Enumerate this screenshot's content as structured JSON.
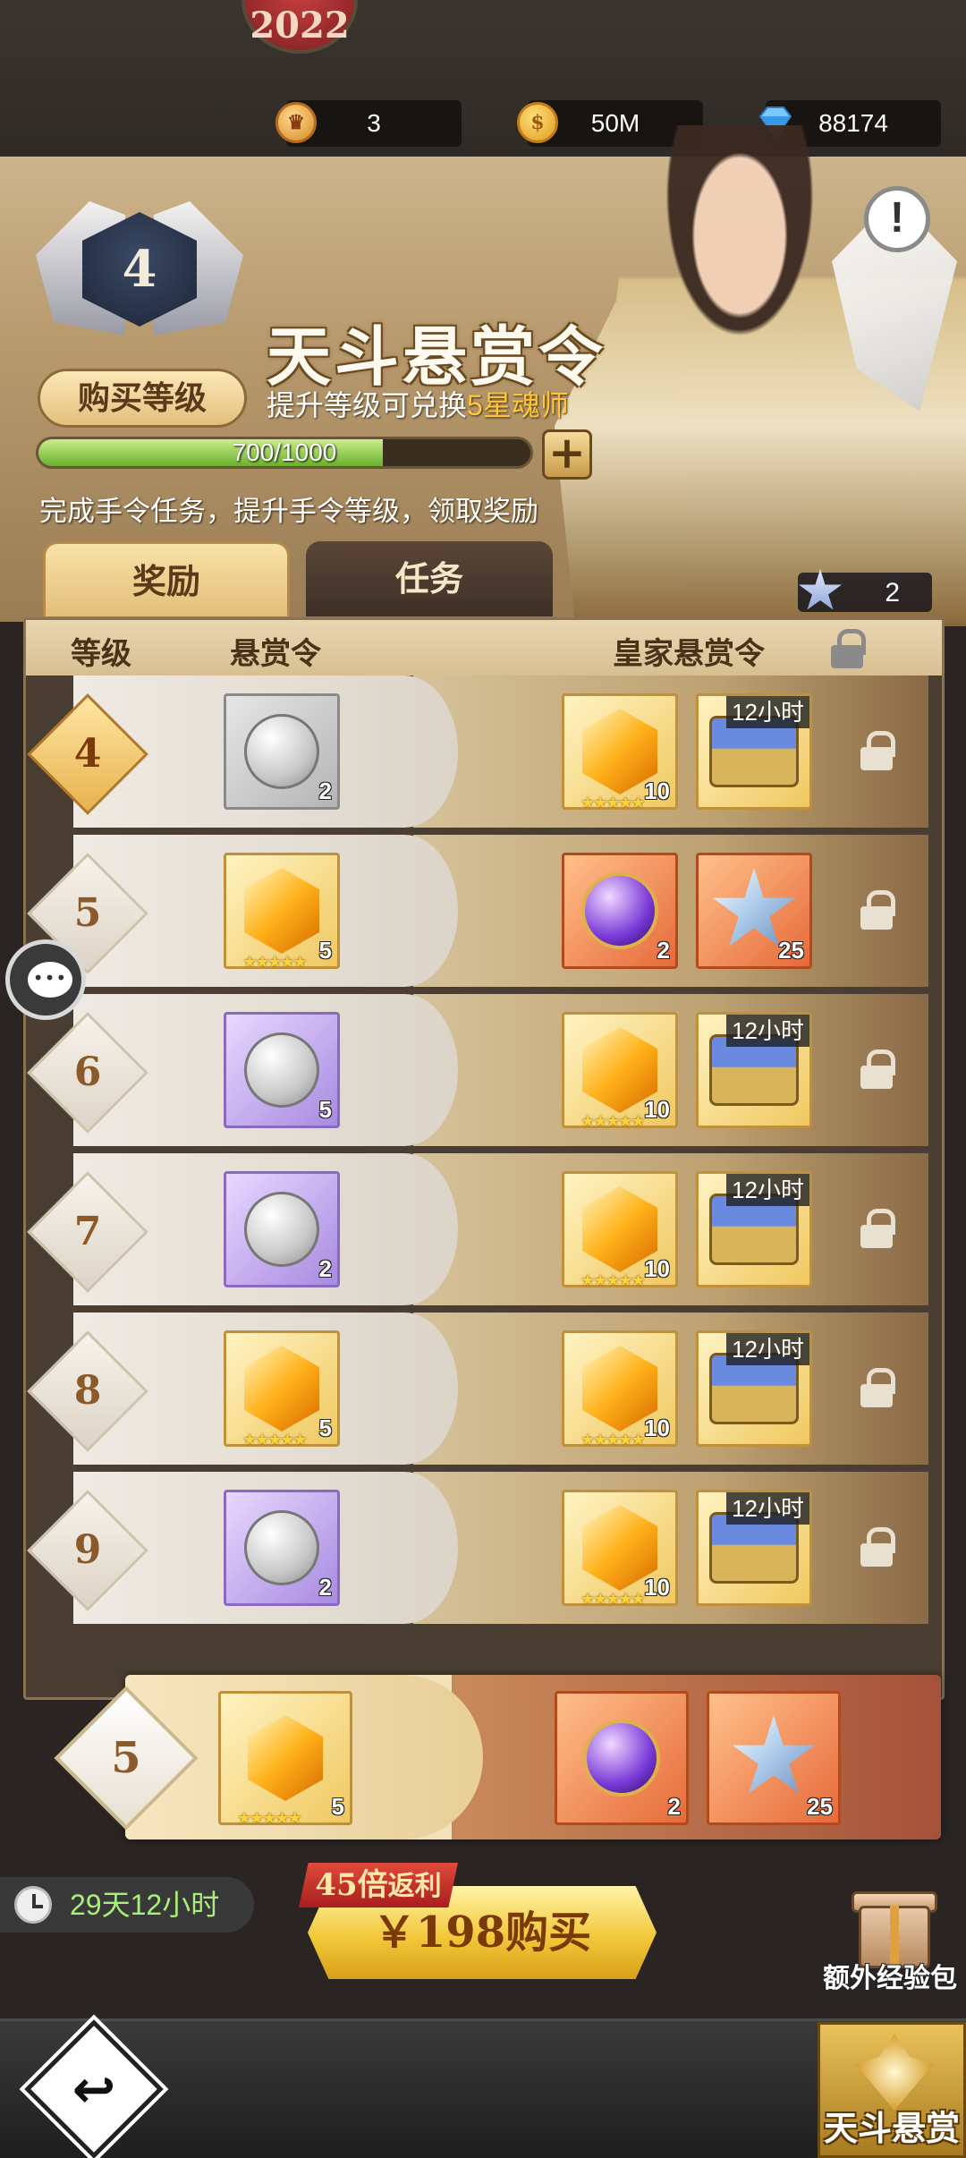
{
  "header": {
    "medal_text": "2022",
    "resources": [
      {
        "icon": "bounty-coin-icon",
        "value": "3"
      },
      {
        "icon": "gold-coin-icon",
        "value": "50M"
      },
      {
        "icon": "diamond-icon",
        "value": "88174"
      }
    ]
  },
  "pass": {
    "level": "4",
    "buy_level_label": "购买等级",
    "title": "天斗悬赏令",
    "subtitle_prefix": "提升等级可兑换",
    "subtitle_highlight": "5星魂师",
    "progress_text": "700/1000",
    "progress_fraction": 0.7,
    "plus_label": "+",
    "hint": "完成手令任务，提升手令等级，领取奖励",
    "info_label": "!",
    "star_count": "2"
  },
  "tabs": [
    {
      "label": "奖励",
      "active": true
    },
    {
      "label": "任务",
      "active": false
    }
  ],
  "list": {
    "headers": {
      "level": "等级",
      "free": "悬赏令",
      "royal": "皇家悬赏令"
    },
    "rows": [
      {
        "level": "4",
        "active": true,
        "free": {
          "icon": "silver-coin-icon",
          "bg": "gray",
          "qty": "2"
        },
        "royal": [
          {
            "icon": "crystal-icon",
            "bg": "gold",
            "qty": "10",
            "stars": "★★★★★"
          },
          {
            "icon": "chest-icon",
            "bg": "gold",
            "qty": "",
            "timer": "12小时"
          }
        ]
      },
      {
        "level": "5",
        "active": false,
        "free": {
          "icon": "crystal-icon",
          "bg": "gold",
          "qty": "5",
          "stars": "★★★★★"
        },
        "royal": [
          {
            "icon": "purple-orb-icon",
            "bg": "orange",
            "qty": "2"
          },
          {
            "icon": "star-shard-icon",
            "bg": "orange",
            "qty": "25"
          }
        ]
      },
      {
        "level": "6",
        "active": false,
        "free": {
          "icon": "silver-coin-icon",
          "bg": "purple",
          "qty": "5"
        },
        "royal": [
          {
            "icon": "crystal-icon",
            "bg": "gold",
            "qty": "10",
            "stars": "★★★★★"
          },
          {
            "icon": "chest-icon",
            "bg": "gold",
            "qty": "",
            "timer": "12小时"
          }
        ]
      },
      {
        "level": "7",
        "active": false,
        "free": {
          "icon": "silver-coin-icon",
          "bg": "purple",
          "qty": "2"
        },
        "royal": [
          {
            "icon": "crystal-icon",
            "bg": "gold",
            "qty": "10",
            "stars": "★★★★★"
          },
          {
            "icon": "chest-icon",
            "bg": "gold",
            "qty": "",
            "timer": "12小时"
          }
        ]
      },
      {
        "level": "8",
        "active": false,
        "free": {
          "icon": "crystal-icon",
          "bg": "gold",
          "qty": "5",
          "stars": "★★★★★"
        },
        "royal": [
          {
            "icon": "crystal-icon",
            "bg": "gold",
            "qty": "10",
            "stars": "★★★★★"
          },
          {
            "icon": "chest-icon",
            "bg": "gold",
            "qty": "",
            "timer": "12小时"
          }
        ]
      },
      {
        "level": "9",
        "active": false,
        "free": {
          "icon": "silver-coin-icon",
          "bg": "purple",
          "qty": "2"
        },
        "royal": [
          {
            "icon": "crystal-icon",
            "bg": "gold",
            "qty": "10",
            "stars": "★★★★★"
          },
          {
            "icon": "chest-icon",
            "bg": "gold",
            "qty": "",
            "timer": "12小时"
          }
        ]
      }
    ]
  },
  "preview": {
    "level": "5",
    "free": {
      "icon": "crystal-icon",
      "bg": "gold",
      "qty": "5",
      "stars": "★★★★★"
    },
    "royal": [
      {
        "icon": "purple-orb-icon",
        "bg": "orange",
        "qty": "2"
      },
      {
        "icon": "star-shard-icon",
        "bg": "orange",
        "qty": "25"
      }
    ]
  },
  "footer": {
    "time_left": "29天12小时",
    "bonus_num": "45倍",
    "bonus_text": "返利",
    "buy_label": "￥198购买",
    "gift_label": "额外经验包",
    "back_glyph": "↩",
    "bounty_tab_label": "天斗悬赏"
  }
}
